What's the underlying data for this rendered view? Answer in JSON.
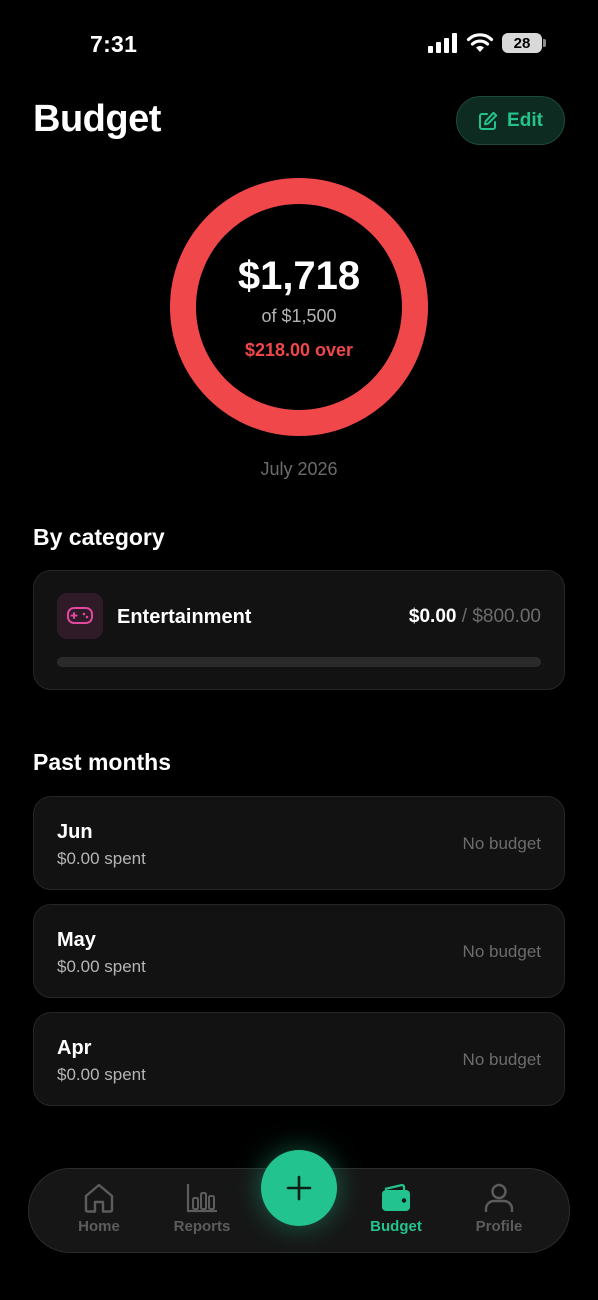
{
  "status_bar": {
    "time": "7:31",
    "battery": "28"
  },
  "header": {
    "title": "Budget",
    "edit_label": "Edit"
  },
  "summary": {
    "amount": "$1,718",
    "of_text": "of $1,500",
    "over_text": "$218.00 over",
    "period": "July 2026",
    "ring_color": "#f0474a"
  },
  "by_category": {
    "title": "By category",
    "items": [
      {
        "name": "Entertainment",
        "spent": "$0.00",
        "separator": " / ",
        "limit": "$800.00",
        "progress": 0,
        "icon": "gamepad-icon",
        "icon_color": "#e0479e"
      }
    ]
  },
  "past_months": {
    "title": "Past months",
    "items": [
      {
        "month": "Jun",
        "spent": "$0.00 spent",
        "status": "No budget"
      },
      {
        "month": "May",
        "spent": "$0.00 spent",
        "status": "No budget"
      },
      {
        "month": "Apr",
        "spent": "$0.00 spent",
        "status": "No budget"
      }
    ]
  },
  "tabbar": {
    "tabs": [
      {
        "label": "Home",
        "icon": "home-icon"
      },
      {
        "label": "Reports",
        "icon": "bar-chart-icon"
      },
      {
        "label": "Budget",
        "icon": "wallet-icon",
        "active": true
      },
      {
        "label": "Profile",
        "icon": "user-icon"
      }
    ],
    "add_icon": "plus-icon"
  },
  "colors": {
    "accent": "#22c38e",
    "over": "#f0474a",
    "background": "#000000"
  }
}
